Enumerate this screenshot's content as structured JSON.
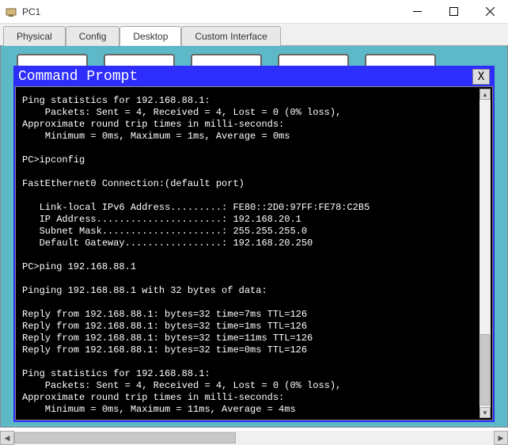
{
  "window": {
    "title": "PC1"
  },
  "tabs": {
    "items": [
      {
        "label": "Physical"
      },
      {
        "label": "Config"
      },
      {
        "label": "Desktop"
      },
      {
        "label": "Custom Interface"
      }
    ],
    "active_index": 2
  },
  "cmd": {
    "title": "Command Prompt",
    "close_label": "X",
    "lines": [
      "Ping statistics for 192.168.88.1:",
      "    Packets: Sent = 4, Received = 4, Lost = 0 (0% loss),",
      "Approximate round trip times in milli-seconds:",
      "    Minimum = 0ms, Maximum = 1ms, Average = 0ms",
      "",
      "PC>ipconfig",
      "",
      "FastEthernet0 Connection:(default port)",
      "",
      "   Link-local IPv6 Address.........: FE80::2D0:97FF:FE78:C2B5",
      "   IP Address......................: 192.168.20.1",
      "   Subnet Mask.....................: 255.255.255.0",
      "   Default Gateway.................: 192.168.20.250",
      "",
      "PC>ping 192.168.88.1",
      "",
      "Pinging 192.168.88.1 with 32 bytes of data:",
      "",
      "Reply from 192.168.88.1: bytes=32 time=7ms TTL=126",
      "Reply from 192.168.88.1: bytes=32 time=1ms TTL=126",
      "Reply from 192.168.88.1: bytes=32 time=11ms TTL=126",
      "Reply from 192.168.88.1: bytes=32 time=0ms TTL=126",
      "",
      "Ping statistics for 192.168.88.1:",
      "    Packets: Sent = 4, Received = 4, Lost = 0 (0% loss),",
      "Approximate round trip times in milli-seconds:",
      "    Minimum = 0ms, Maximum = 11ms, Average = 4ms",
      ""
    ],
    "prompt": "PC>"
  }
}
